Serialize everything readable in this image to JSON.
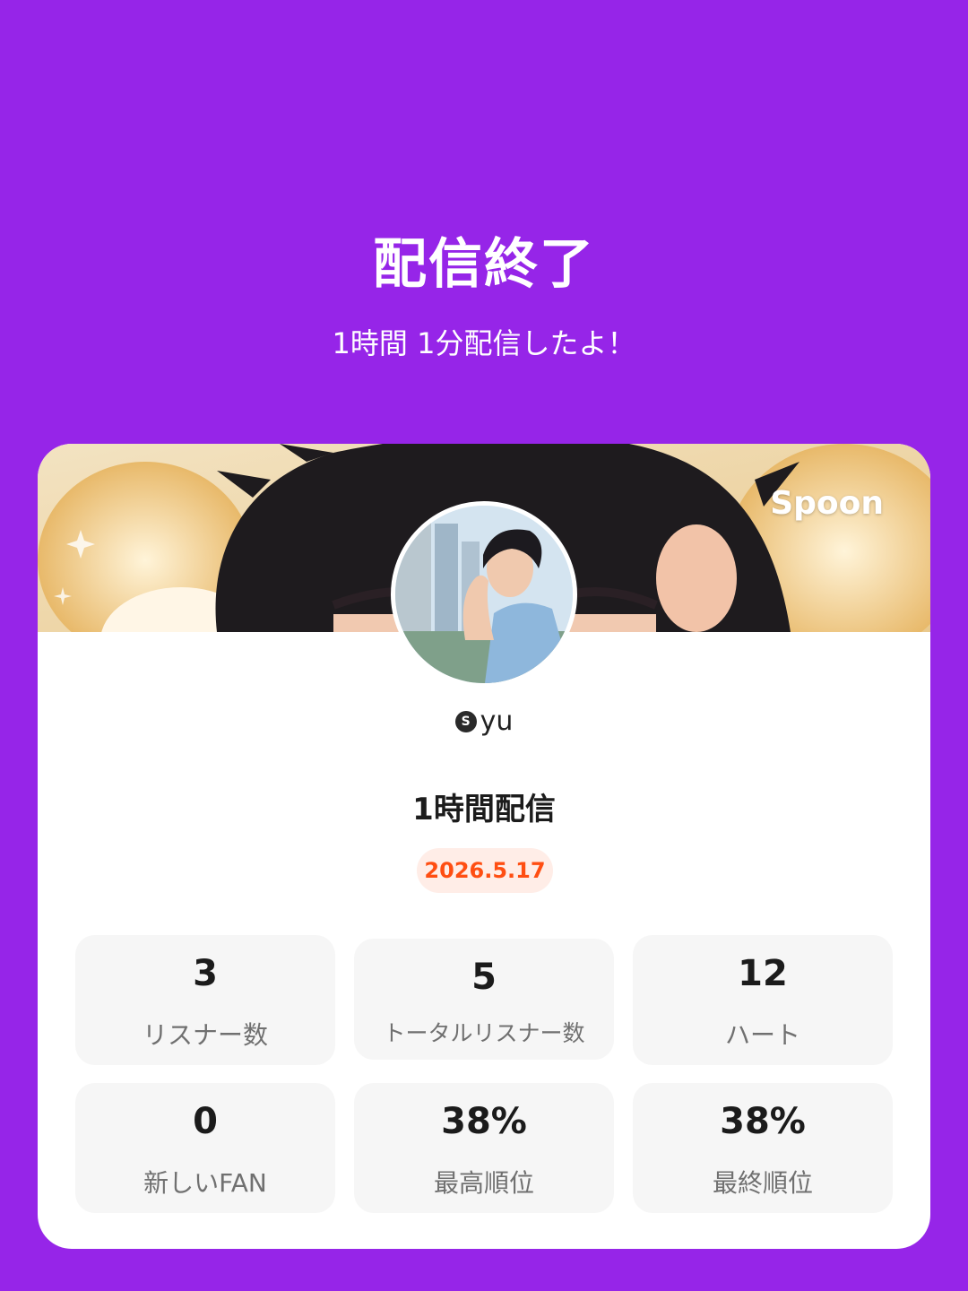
{
  "header": {
    "title": "配信終了",
    "subtitle": "1時間 1分配信したよ！"
  },
  "card": {
    "brand": "Spoon",
    "user": {
      "badge": "S",
      "name": "yu"
    },
    "broadcast_title": "1時間配信",
    "date": "2026.5.17",
    "stats": [
      {
        "value": "3",
        "label": "リスナー数"
      },
      {
        "value": "5",
        "label": "トータルリスナー数"
      },
      {
        "value": "12",
        "label": "ハート"
      },
      {
        "value": "0",
        "label": "新しいFAN"
      },
      {
        "value": "38%",
        "label": "最高順位"
      },
      {
        "value": "38%",
        "label": "最終順位"
      }
    ]
  },
  "colors": {
    "background": "#9625E8",
    "card": "#FFFFFF",
    "date_text": "#FF4E12",
    "date_bg": "#FFEDE7",
    "stat_bg": "#F6F6F6"
  }
}
